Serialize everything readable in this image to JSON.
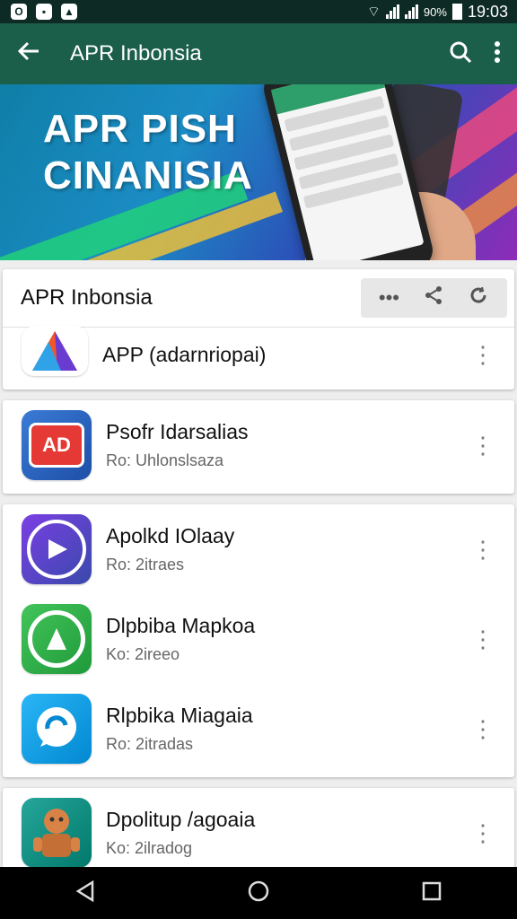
{
  "status_bar": {
    "battery": "90%",
    "time": "19:03"
  },
  "app_bar": {
    "title": "APR Inbonsia"
  },
  "banner": {
    "line1": "APR PISH",
    "line2": "CINANISIA"
  },
  "card_header": {
    "title": "APR Inbonsia"
  },
  "rows": [
    {
      "name": "APP (adarnriopai)",
      "sub": ""
    },
    {
      "name": "Psofr Idarsalias",
      "sub": "Ro: Uhlonslsaza"
    },
    {
      "name": "Apolkd IOlaay",
      "sub": "Ro: 2itraes"
    },
    {
      "name": "Dlpbiba Mapkoa",
      "sub": "Ko: 2ireeo"
    },
    {
      "name": "Rlpbika Miagaia",
      "sub": "Ro: 2itradas"
    },
    {
      "name": "Dpolitup /agoaia",
      "sub": "Ko: 2ilradog"
    }
  ],
  "colors": {
    "appbar": "#1b5e49",
    "status_bar": "#0d2b24"
  }
}
